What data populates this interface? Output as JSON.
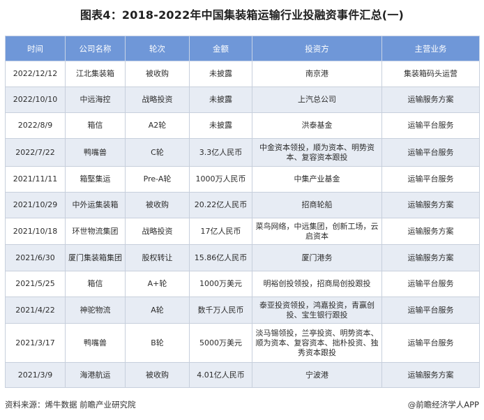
{
  "title": "图表4：2018-2022年中国集装箱运输行业投融资事件汇总(一)",
  "table": {
    "headers": [
      "时间",
      "公司名称",
      "轮次",
      "金额",
      "投资方",
      "主营业务"
    ],
    "rows": [
      [
        "2022/12/12",
        "江北集装箱",
        "被收购",
        "未披露",
        "南京港",
        "集装箱码头运营"
      ],
      [
        "2022/10/10",
        "中远海控",
        "战略投资",
        "未披露",
        "上汽总公司",
        "运输服务方案"
      ],
      [
        "2022/8/9",
        "箱信",
        "A2轮",
        "未披露",
        "洪泰基金",
        "运输平台服务"
      ],
      [
        "2022/7/22",
        "鸭嘴兽",
        "C轮",
        "3.3亿人民币",
        "中金资本领投，顺为资本、明势资本、复容资本跟投",
        "运输平台服务"
      ],
      [
        "2021/11/11",
        "箱堅集运",
        "Pre-A轮",
        "1000万人民币",
        "中集产业基金",
        "运输平台服务"
      ],
      [
        "2021/10/29",
        "中外运集装箱",
        "被收购",
        "20.22亿人民币",
        "招商轮船",
        "运输服务方案"
      ],
      [
        "2021/10/18",
        "环世物流集团",
        "战略投资",
        "17亿人民币",
        "菜鸟网络，中远集团，创新工场，云启资本",
        "运输服务方案"
      ],
      [
        "2021/6/30",
        "厦门集装箱集团",
        "股权转让",
        "15.86亿人民币",
        "厦门港务",
        "运输服务方案"
      ],
      [
        "2021/5/25",
        "箱信",
        "A+轮",
        "1000万美元",
        "明裕创投领投，招商局创投跟投",
        "运输平台服务"
      ],
      [
        "2021/4/22",
        "神驼物流",
        "A轮",
        "数千万人民币",
        "泰亚投资领投，鸿嘉投资，青赢创投、宝生银行跟投",
        "运输平台服务"
      ],
      [
        "2021/3/17",
        "鸭嘴兽",
        "B轮",
        "5000万美元",
        "淡马锡领投，兰亭投资、明势资本、顺为资本、复容资本、拙朴投资、独秀资本跟投",
        "运输平台服务"
      ],
      [
        "2021/3/9",
        "海港航运",
        "被收购",
        "4.01亿人民币",
        "宁波港",
        "运输服务方案"
      ]
    ]
  },
  "footer": {
    "source": "资料来源：烯牛数据 前瞻产业研究院",
    "brand": "@前瞻经济学人APP"
  }
}
